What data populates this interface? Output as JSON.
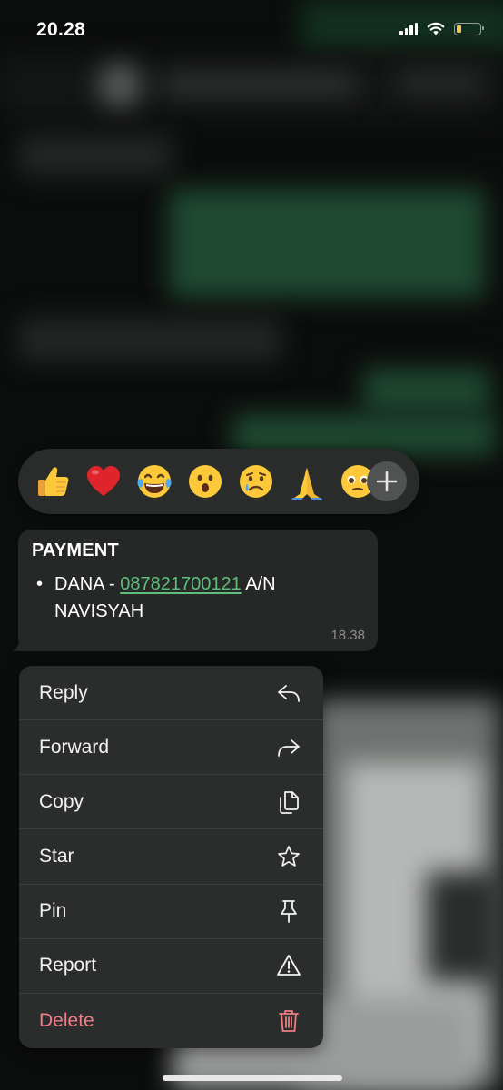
{
  "status_bar": {
    "time": "20.28",
    "battery_level": 0.2
  },
  "reactions": {
    "emojis": [
      "thumbs-up",
      "red-heart",
      "tears-of-joy",
      "surprised-face",
      "crying-face",
      "folded-hands",
      "face-holding-back-tears"
    ],
    "more_icon": "plus-icon"
  },
  "message": {
    "title": "PAYMENT",
    "bullet": "•",
    "line_prefix": "DANA - ",
    "phone": "087821700121",
    "line_suffix": " A/N NAVISYAH",
    "time": "18.38"
  },
  "menu": {
    "items": [
      {
        "label": "Reply",
        "icon": "reply-icon"
      },
      {
        "label": "Forward",
        "icon": "forward-icon"
      },
      {
        "label": "Copy",
        "icon": "copy-icon"
      },
      {
        "label": "Star",
        "icon": "star-icon"
      },
      {
        "label": "Pin",
        "icon": "pin-icon"
      },
      {
        "label": "Report",
        "icon": "warning-icon"
      },
      {
        "label": "Delete",
        "icon": "trash-icon"
      }
    ]
  },
  "colors": {
    "link": "#5fbe7a",
    "delete": "#ef7d86",
    "menu_bg": "#2b2d2c",
    "bubble_bg": "#262828"
  }
}
